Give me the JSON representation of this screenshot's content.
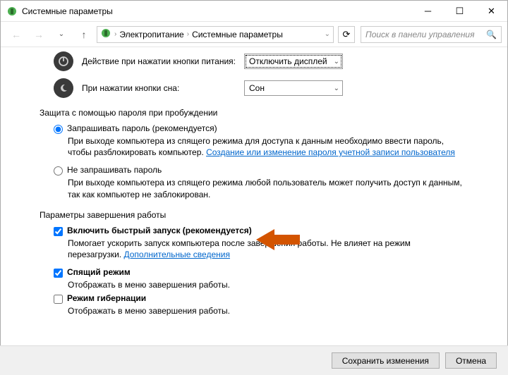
{
  "window": {
    "title": "Системные параметры"
  },
  "breadcrumb": {
    "item1": "Электропитание",
    "item2": "Системные параметры"
  },
  "search": {
    "placeholder": "Поиск в панели управления"
  },
  "actions": {
    "power_button": {
      "label": "Действие при нажатии кнопки питания:",
      "value": "Отключить дисплей"
    },
    "sleep_button": {
      "label": "При нажатии кнопки сна:",
      "value": "Сон"
    }
  },
  "sections": {
    "wake_protect": {
      "heading": "Защита с помощью пароля при пробуждении",
      "require": {
        "label": "Запрашивать пароль (рекомендуется)",
        "desc_pre": "При выходе компьютера из спящего режима для доступа к данным необходимо ввести пароль, чтобы разблокировать компьютер. ",
        "link": "Создание или изменение пароля учетной записи пользователя"
      },
      "norequire": {
        "label": "Не запрашивать пароль",
        "desc": "При выходе компьютера из спящего режима любой пользователь может получить доступ к данным, так как компьютер не заблокирован."
      }
    },
    "shutdown": {
      "heading": "Параметры завершения работы",
      "fast": {
        "label": "Включить быстрый запуск (рекомендуется)",
        "desc_pre": "Помогает ускорить запуск компьютера после завершения работы. Не влияет на режим перезагрузки. ",
        "link": "Дополнительные сведения"
      },
      "sleep": {
        "label": "Спящий режим",
        "desc": "Отображать в меню завершения работы."
      },
      "hiber": {
        "label": "Режим гибернации",
        "desc": "Отображать в меню завершения работы."
      }
    }
  },
  "footer": {
    "save": "Сохранить изменения",
    "cancel": "Отмена"
  }
}
